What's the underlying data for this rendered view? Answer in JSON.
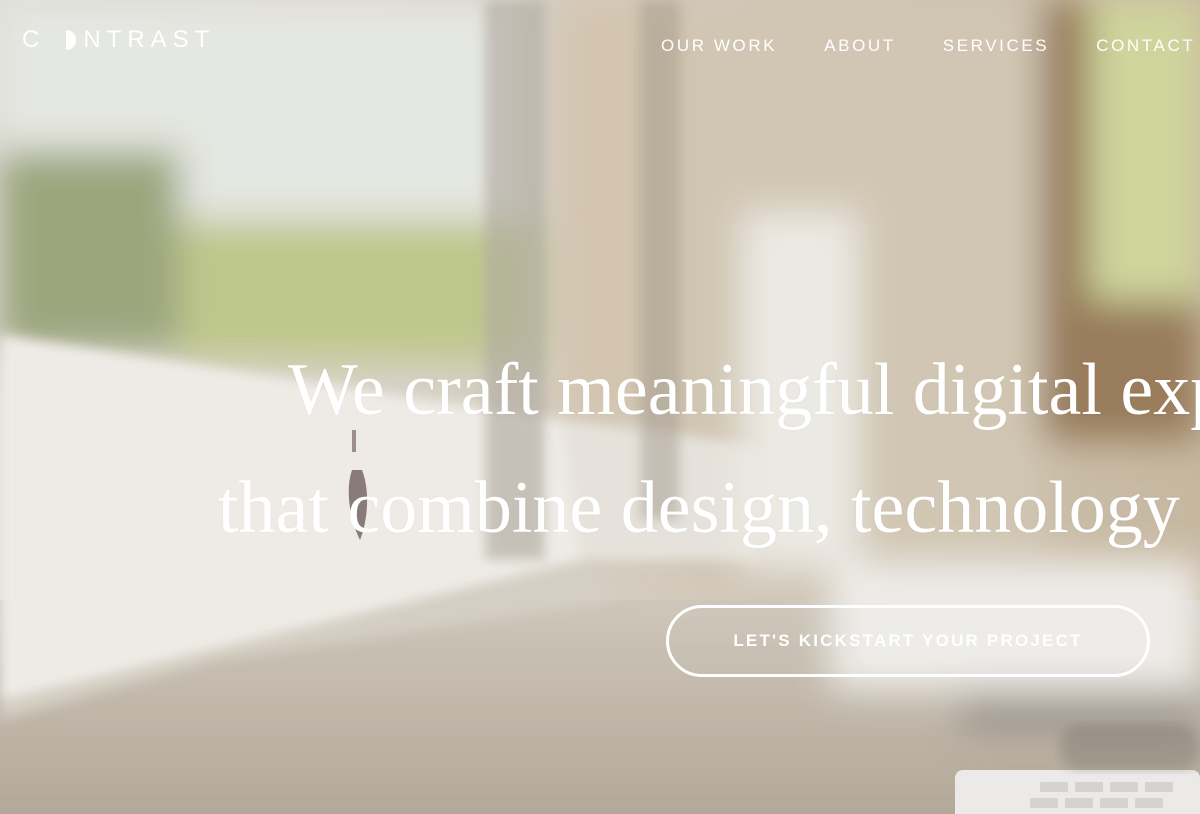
{
  "brand": {
    "logo_text_prefix": "C",
    "logo_text_suffix": "NTRAST",
    "logo_icon": "half-moon-o-icon"
  },
  "nav": {
    "items": [
      {
        "label": "OUR WORK"
      },
      {
        "label": "ABOUT"
      },
      {
        "label": "SERVICES"
      },
      {
        "label": "CONTACT"
      }
    ]
  },
  "hero": {
    "headline_line1": "We craft meaningful digital experiences",
    "headline_line2": "that combine design, technology",
    "cta_label": "LET'S KICKSTART YOUR PROJECT",
    "background_description_colors": {
      "overlay": "#ffffff",
      "wall": "#d8d0c4",
      "desk": "#b8ad9c",
      "window_green": "#a8b77a",
      "wood": "#8a6a4a"
    }
  }
}
